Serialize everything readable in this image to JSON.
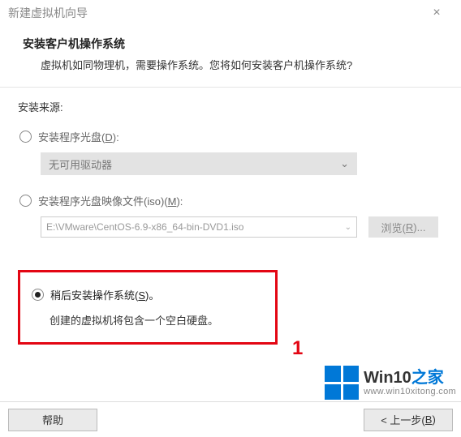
{
  "window": {
    "title": "新建虚拟机向导"
  },
  "header": {
    "title": "安装客户机操作系统",
    "subtitle": "虚拟机如同物理机，需要操作系统。您将如何安装客户机操作系统?"
  },
  "source": {
    "label": "安装来源:",
    "opt_disc": {
      "text": "安装程序光盘(",
      "key": "D",
      "suffix": "):"
    },
    "disc_dropdown": "无可用驱动器",
    "opt_iso": {
      "text": "安装程序光盘映像文件(iso)(",
      "key": "M",
      "suffix": "):"
    },
    "iso_path": "E:\\VMware\\CentOS-6.9-x86_64-bin-DVD1.iso",
    "browse": {
      "text": "浏览(",
      "key": "R",
      "suffix": ")..."
    },
    "opt_later": {
      "text": "稍后安装操作系统(",
      "key": "S",
      "suffix": ")。"
    },
    "later_desc": "创建的虚拟机将包含一个空白硬盘。"
  },
  "marker": "1",
  "footer": {
    "help": "帮助",
    "back": {
      "prefix": "< 上一步(",
      "key": "B",
      "suffix": ")"
    }
  },
  "watermark": {
    "brand_a": "Win10",
    "brand_b": "之家",
    "url": "www.win10xitong.com"
  }
}
